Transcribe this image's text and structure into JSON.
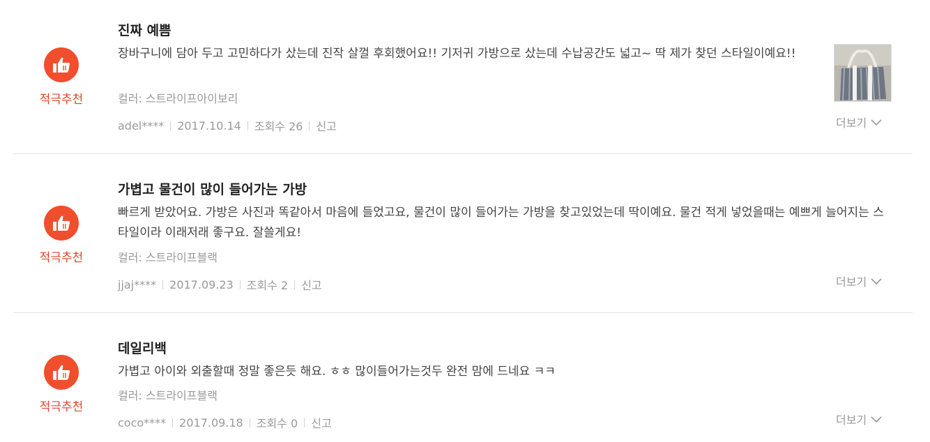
{
  "reviews": [
    {
      "badge_label": "적극추천",
      "title": "진짜 예쁨",
      "body": "장바구니에 담아 두고 고민하다가 샀는데 진작 살껄 후회했어요!! 기저귀 가방으로 샀는데 수납공간도 넓고~ 딱 제가 찾던 스타일이예요!!",
      "option": "컬러: 스트라이프아이보리",
      "author": "adel****",
      "date": "2017.10.14",
      "views": "조회수 26",
      "report": "신고",
      "more": "더보기",
      "thumbnail": "bag-thumbnail"
    },
    {
      "badge_label": "적극추천",
      "title": "가볍고 물건이 많이 들어가는 가방",
      "body": "빠르게 받았어요. 가방은 사진과 똑같아서 마음에 들었고요, 물건이 많이 들어가는 가방을 찾고있었는데 딱이예요. 물건 적게 넣었을때는 예쁘게 늘어지는 스타일이라 이래저래 좋구요. 잘쓸게요!",
      "option": "컬러: 스트라이프블랙",
      "author": "jjaj****",
      "date": "2017.09.23",
      "views": "조회수 2",
      "report": "신고",
      "more": "더보기"
    },
    {
      "badge_label": "적극추천",
      "title": "데일리백",
      "body": "가볍고 아이와 외출할때 정말 좋은듯 해요. ㅎㅎ 많이들어가는것두 완전 맘에 드네요 ㅋㅋ",
      "option": "컬러: 스트라이프블랙",
      "author": "coco****",
      "date": "2017.09.18",
      "views": "조회수 0",
      "report": "신고",
      "more": "더보기"
    }
  ],
  "colors": {
    "accent": "#f04e2c",
    "badge_text": "#e0452b",
    "muted": "#999999"
  },
  "icons": [
    "thumbs-up-icon",
    "chevron-down-icon"
  ]
}
